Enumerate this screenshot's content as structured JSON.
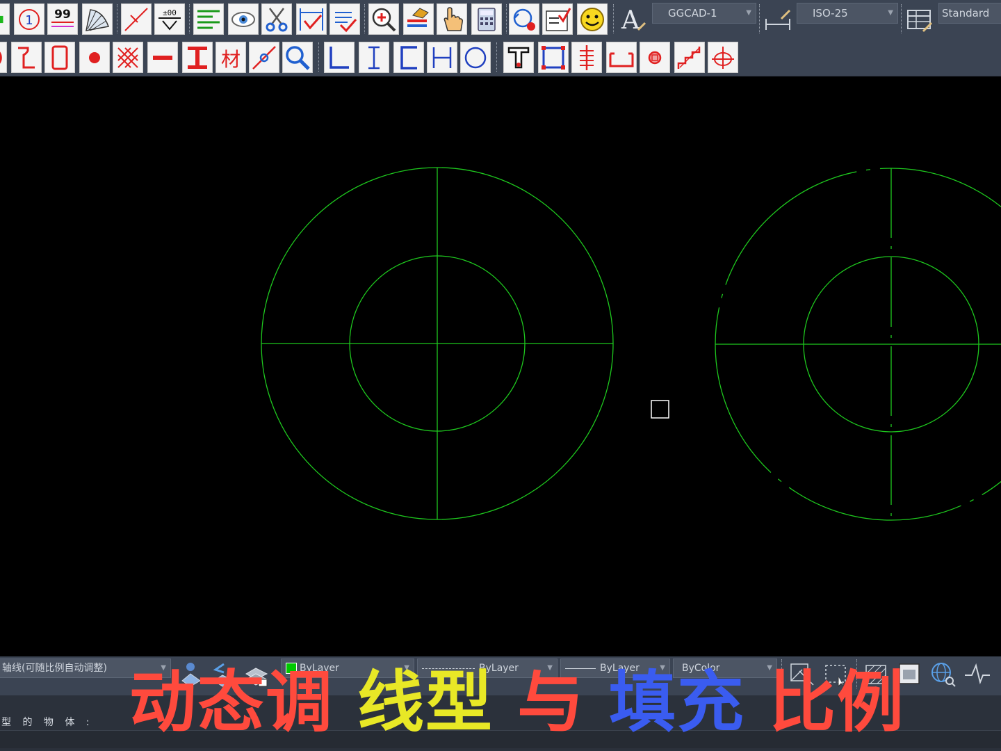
{
  "toolbar_top": {
    "text_style": "GGCAD-1",
    "dim_style": "ISO-25",
    "table_style": "Standard"
  },
  "icons_row1": [
    "insert-block-icon",
    "balloon-number-icon",
    "text-99-icon",
    "fan-hatch-icon",
    "break-line-icon",
    "weld-symbol-icon",
    "align-lines-icon",
    "eye-view-icon",
    "scissors-icon",
    "dimension-check-icon",
    "dimension-edit-icon",
    "zoom-in-icon",
    "layer-match-icon",
    "hand-pick-icon",
    "calculator-icon",
    "rotate-view-icon",
    "checklist-icon",
    "smiley-icon"
  ],
  "icons_row2": [
    "circle-part-icon",
    "step-line-icon",
    "rectangle-part-icon",
    "point-dot-icon",
    "hatch-pattern-icon",
    "minus-line-icon",
    "i-beam-icon",
    "material-text-icon",
    "snap-line-icon",
    "magnifier-icon",
    "angle-steel-icon",
    "i-section-icon",
    "channel-section-icon",
    "h-section-icon",
    "pipe-section-icon",
    "t-section-icon",
    "square-tube-icon",
    "centerline-mark-icon",
    "slot-shape-icon",
    "hole-mark-icon",
    "stair-line-icon",
    "cross-hole-icon"
  ],
  "properties": {
    "layer_name": "轴线(可随比例自动调整)",
    "color": "ByLayer",
    "color_swatch": "#00c800",
    "linetype": "ByLayer",
    "lineweight": "ByLayer",
    "plotstyle": "ByColor"
  },
  "command": {
    "prompt": "型 的 物 体 :"
  },
  "caption": {
    "part1": "动态调",
    "part2": "线型",
    "part3": "与",
    "part4": "填充",
    "part5": "比例",
    "color1": "#ff4a3d",
    "color2": "#e8e826",
    "color3": "#ff4a3d",
    "color4": "#3a5cf0",
    "color5": "#ff4a3d"
  },
  "drawing": {
    "stroke_color": "#1ec81e"
  }
}
